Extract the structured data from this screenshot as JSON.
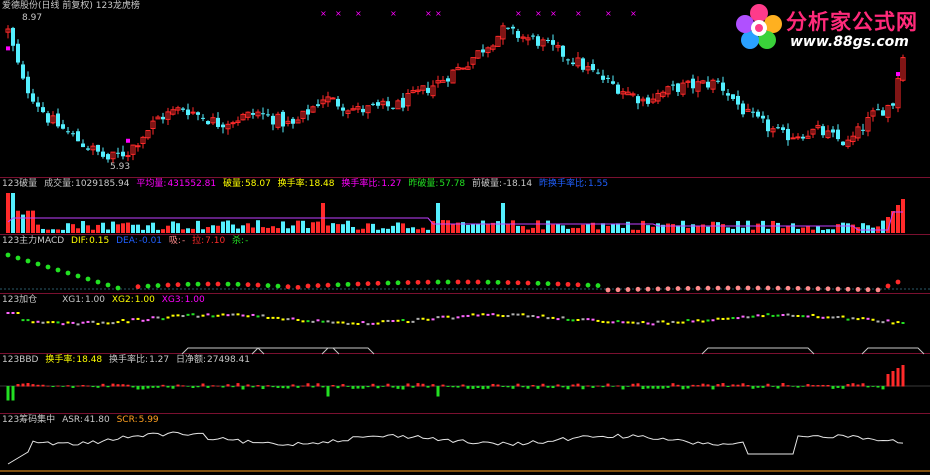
{
  "title": "爱德股份(日线 前复权) 123龙虎榜",
  "price": {
    "high_label": "8.97",
    "low_label": "5.93"
  },
  "logo": {
    "name": "分析家公式网",
    "url": "www.88gs.com",
    "icon": "flower-logo-icon"
  },
  "vol": {
    "title": "123破量",
    "cjl_label": "成交量:",
    "cjl": "1029185.94",
    "pjl_label": "平均量:",
    "pjl": "431552.81",
    "pl_label": "破量:",
    "pl": "58.07",
    "hsl_label": "换手率:",
    "hsl": "18.48",
    "hslb_label": "换手率比:",
    "hslb": "1.27",
    "zpl_label": "昨破量:",
    "zpl": "57.78",
    "qpl_label": "前破量:",
    "qpl": "-18.14",
    "zhslb_label": "昨换手率比:",
    "zhslb": "1.55"
  },
  "macd": {
    "title": "123主力MACD",
    "dif_label": "DIF:",
    "dif": "0.15",
    "dea_label": "DEA:",
    "dea": "-0.01",
    "xi_label": "吸:",
    "xi": "-",
    "la_label": "拉:",
    "la": "7.10",
    "sha_label": "杀:",
    "sha": "-"
  },
  "jc": {
    "title": "123加仓",
    "xg1_label": "XG1:",
    "xg1": "1.00",
    "xg2_label": "XG2:",
    "xg2": "1.00",
    "xg3_label": "XG3:",
    "xg3": "1.00"
  },
  "bbd": {
    "title": "123BBD",
    "hsl_label": "换手率:",
    "hsl": "18.48",
    "hslb_label": "换手率比:",
    "hslb": "1.27",
    "rjz_label": "日净额:",
    "rjz": "27498.41"
  },
  "cm": {
    "title": "123筹码集中",
    "asr_label": "ASR:",
    "asr": "41.80",
    "scr_label": "SCR:",
    "scr": "5.99"
  },
  "colors": {
    "up": "#ff2a2a",
    "down": "#54f0ff",
    "green": "#22e022",
    "magenta": "#ff00ff",
    "yellow": "#ffff00",
    "pink": "#ff8a8a",
    "border": "#7a1030",
    "text": "#c8c8c8",
    "volavg": "#c040ff",
    "dea": "#2060ff",
    "scr": "#ffa020"
  }
}
